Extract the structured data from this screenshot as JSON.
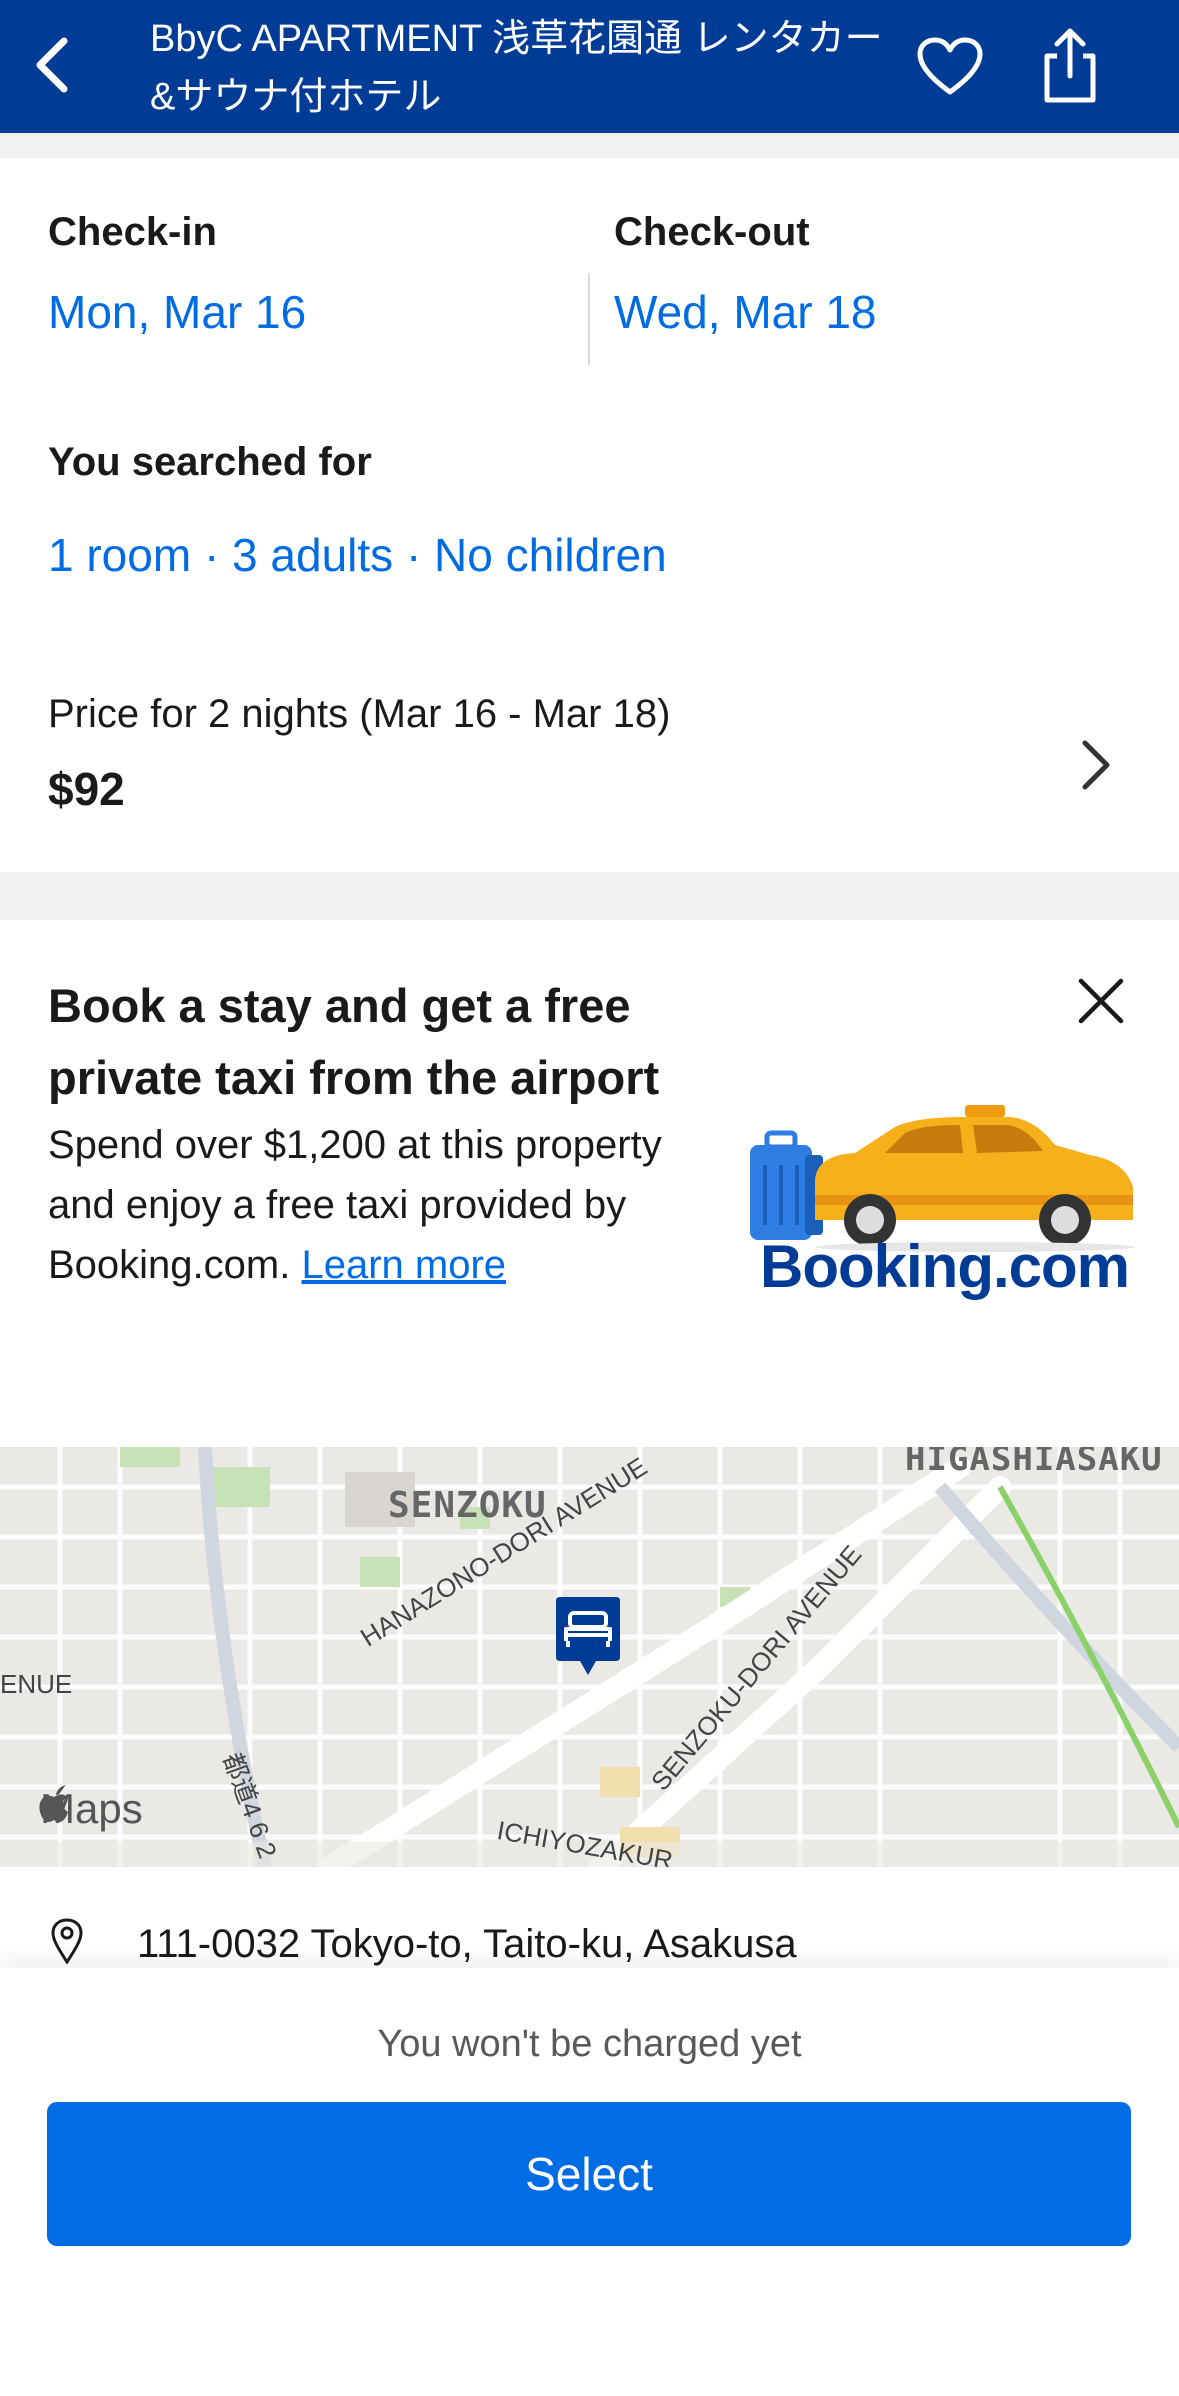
{
  "header": {
    "title": "BbyC APARTMENT 浅草花園通 レンタカー&サウナ付ホテル",
    "back_icon": "chevron-left-icon",
    "favorite_icon": "heart-icon",
    "share_icon": "share-icon",
    "bg_color": "#003b95"
  },
  "dates": {
    "checkin_label": "Check-in",
    "checkin_value": "Mon, Mar 16",
    "checkout_label": "Check-out",
    "checkout_value": "Wed, Mar 18"
  },
  "search": {
    "label": "You searched for",
    "value": "1 room · 3 adults · No children"
  },
  "price": {
    "label": "Price for 2 nights (Mar 16 - Mar 18)",
    "amount": "$92",
    "chevron_icon": "chevron-right-icon"
  },
  "promo": {
    "headline": "Book a stay and get a free private taxi from the airport",
    "description": "Spend over $1,200 at this property and enjoy a free taxi provided by Booking.com.",
    "link_text": "Learn more",
    "brand": "Booking.com",
    "close_icon": "close-icon",
    "image_icon": "taxi-icon"
  },
  "map": {
    "labels": {
      "senzoku": "SENZOKU",
      "higashi": "HIGASHIASAKU",
      "enue": "ENUE",
      "hanazono": "HANAZONO-DORI AVENUE",
      "senzoku_dori": "SENZOKU-DORI AVENUE",
      "ichiyo": "ICHIYOZAKUR",
      "route": "都道4 6 2"
    },
    "watermark": "Maps",
    "marker_icon": "bed-icon"
  },
  "address": {
    "text": "111-0032 Tokyo-to, Taito-ku, Asakusa",
    "pin_icon": "location-pin-icon"
  },
  "footer": {
    "note": "You won't be charged yet",
    "button_label": "Select",
    "accent": "#006ce4"
  }
}
